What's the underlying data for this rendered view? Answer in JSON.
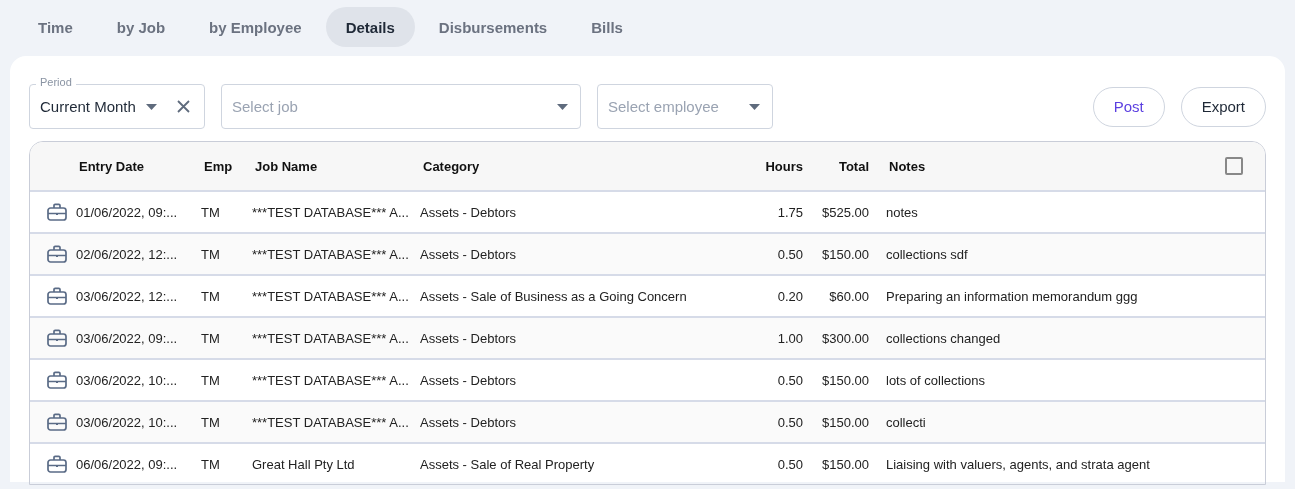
{
  "tabs": [
    {
      "label": "Time",
      "selected": false
    },
    {
      "label": "by Job",
      "selected": false
    },
    {
      "label": "by Employee",
      "selected": false
    },
    {
      "label": "Details",
      "selected": true
    },
    {
      "label": "Disbursements",
      "selected": false
    },
    {
      "label": "Bills",
      "selected": false
    }
  ],
  "filters": {
    "period": {
      "label": "Period",
      "value": "Current Month"
    },
    "job": {
      "placeholder": "Select job"
    },
    "employee": {
      "placeholder": "Select employee"
    }
  },
  "actions": [
    {
      "label": "Post",
      "kind": "primary"
    },
    {
      "label": "Export",
      "kind": "default"
    }
  ],
  "table": {
    "columns": [
      "Entry Date",
      "Emp",
      "Job Name",
      "Category",
      "Hours",
      "Total",
      "Notes"
    ],
    "select_all": {
      "checked": false
    },
    "rows": [
      {
        "entry_date": "01/06/2022, 09:...",
        "emp": "TM",
        "job_name": "***TEST DATABASE*** A...",
        "category": "Assets - Debtors",
        "hours": "1.75",
        "total": "$525.00",
        "notes": "notes"
      },
      {
        "entry_date": "02/06/2022, 12:...",
        "emp": "TM",
        "job_name": "***TEST DATABASE*** A...",
        "category": "Assets - Debtors",
        "hours": "0.50",
        "total": "$150.00",
        "notes": "collections sdf"
      },
      {
        "entry_date": "03/06/2022, 12:...",
        "emp": "TM",
        "job_name": "***TEST DATABASE*** A...",
        "category": "Assets - Sale of Business as a Going Concern",
        "hours": "0.20",
        "total": "$60.00",
        "notes": "Preparing an information memorandum ggg"
      },
      {
        "entry_date": "03/06/2022, 09:...",
        "emp": "TM",
        "job_name": "***TEST DATABASE*** A...",
        "category": "Assets - Debtors",
        "hours": "1.00",
        "total": "$300.00",
        "notes": "collections changed"
      },
      {
        "entry_date": "03/06/2022, 10:...",
        "emp": "TM",
        "job_name": "***TEST DATABASE*** A...",
        "category": "Assets - Debtors",
        "hours": "0.50",
        "total": "$150.00",
        "notes": "lots of collections"
      },
      {
        "entry_date": "03/06/2022, 10:...",
        "emp": "TM",
        "job_name": "***TEST DATABASE*** A...",
        "category": "Assets - Debtors",
        "hours": "0.50",
        "total": "$150.00",
        "notes": "collecti"
      },
      {
        "entry_date": "06/06/2022, 09:...",
        "emp": "TM",
        "job_name": "Great Hall Pty Ltd",
        "category": "Assets - Sale of Real Property",
        "hours": "0.50",
        "total": "$150.00",
        "notes": "Liaising with valuers, agents, and strata agent"
      }
    ]
  }
}
